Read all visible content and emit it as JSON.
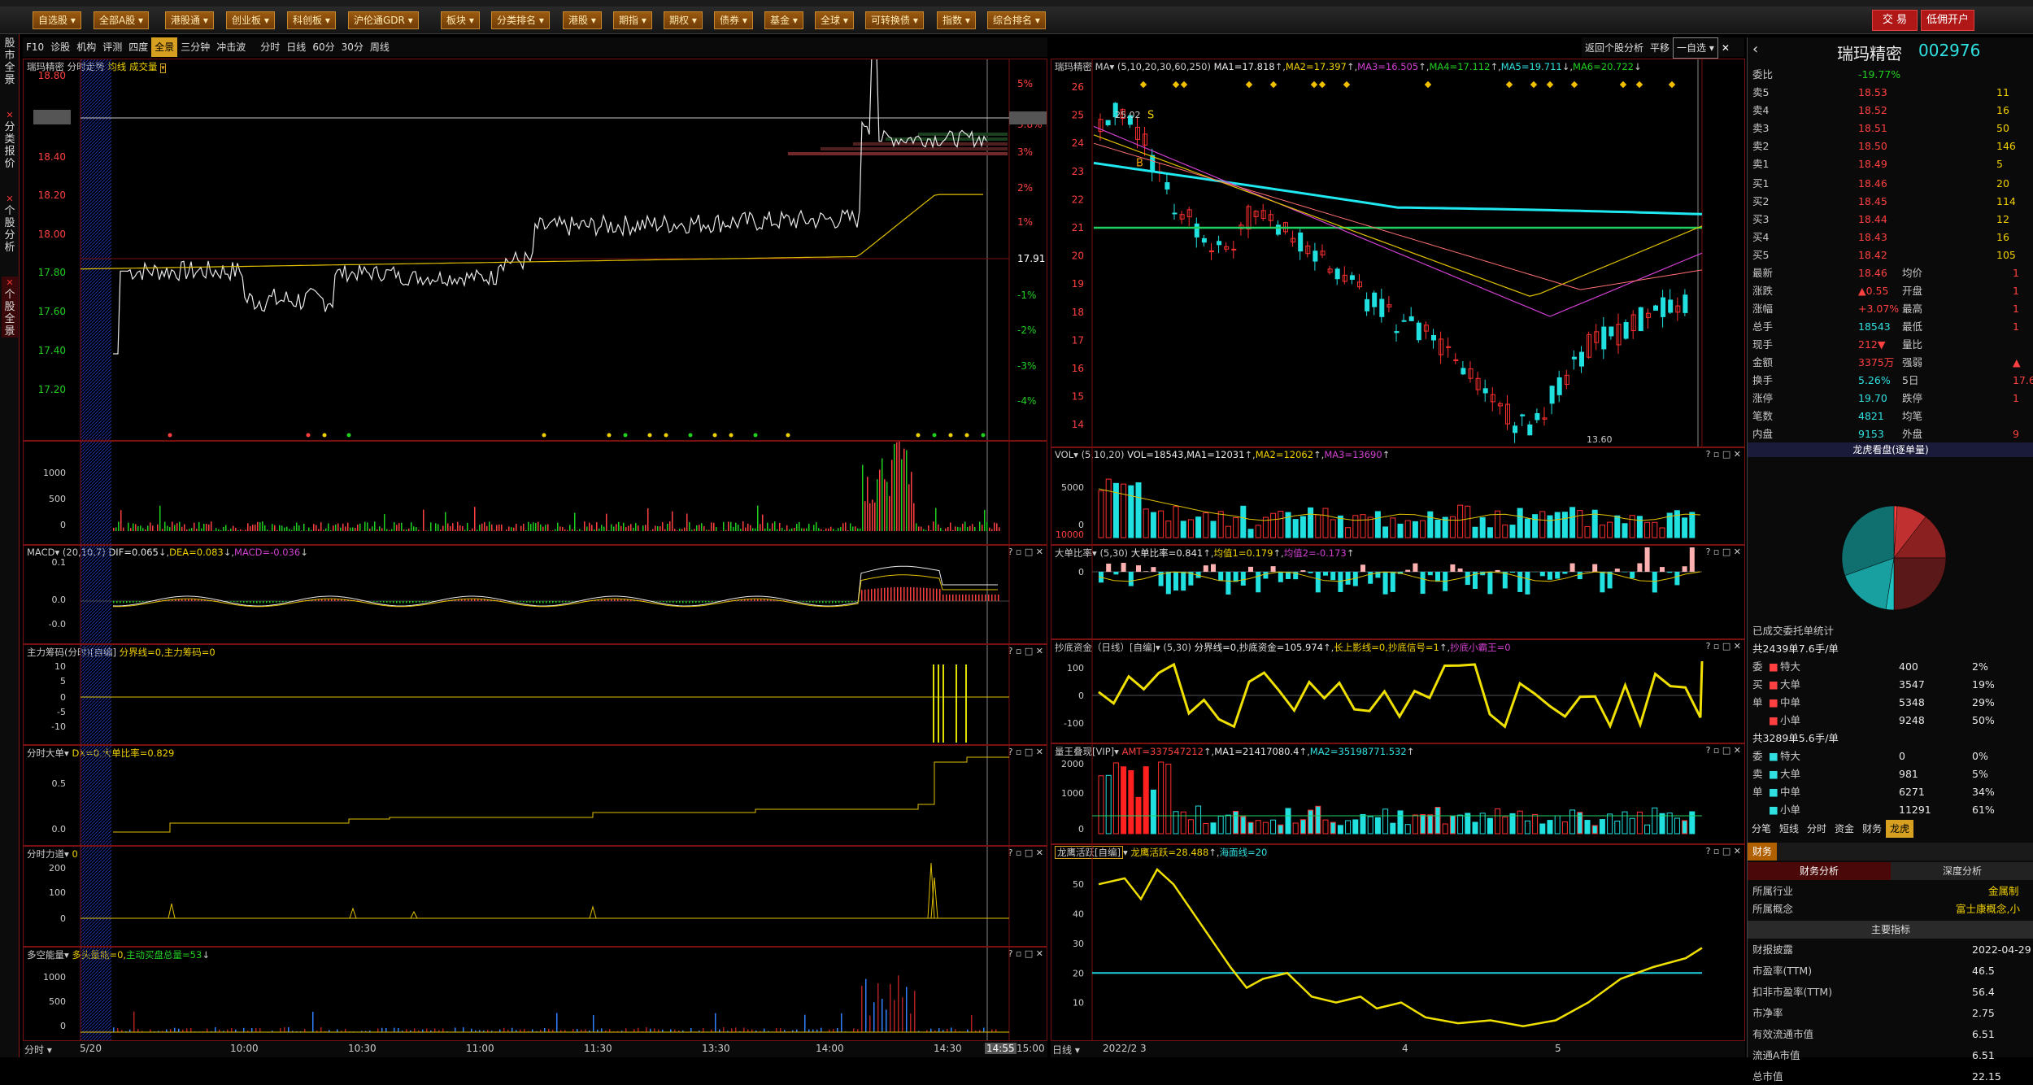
{
  "menu": {
    "items": [
      "自选股",
      "全部A股",
      "港股通",
      "创业板",
      "科创板",
      "沪伦通GDR",
      "板块",
      "分类排名",
      "港股",
      "期指",
      "期权",
      "债券",
      "基金",
      "全球",
      "可转换债",
      "指数",
      "综合排名"
    ],
    "trade": "交 易",
    "open_account": "低佣开户"
  },
  "side_tabs": [
    "股市全景",
    "分类报价",
    "个股分析",
    "个股全景"
  ],
  "toolbar_left": [
    "F10",
    "诊股",
    "机构",
    "评测",
    "四度",
    "全景",
    "三分钟",
    "冲击波",
    "分时",
    "日线",
    "60分",
    "30分",
    "周线"
  ],
  "toolbar_right": [
    "返回个股分析",
    "平移",
    "一自选"
  ],
  "intraday": {
    "title": "瑞玛精密",
    "sub": "分时走势",
    "line_avg": "均线",
    "vol": "成交量",
    "price_ticks": [
      "18.80",
      "18.59",
      "18.40",
      "18.20",
      "18.00",
      "17.80",
      "17.60",
      "17.40",
      "17.20"
    ],
    "pct_ticks": [
      "5%",
      "3.8%",
      "3%",
      "2%",
      "1%",
      "17.91",
      "-1%",
      "-2%",
      "-3%",
      "-4%"
    ],
    "vol_ticks": [
      "1000",
      "500",
      "0"
    ]
  },
  "macd": {
    "label": "MACD",
    "params": "(20,10,7)",
    "dif": "DIF=0.065",
    "dea": "DEA=0.083",
    "macd": "MACD=-0.036",
    "ticks": [
      "0.1",
      "0.0",
      "-0.0"
    ]
  },
  "zl": {
    "label": "主力筹码(分时)[自编]",
    "desc": "分界线=0,主力筹码=0",
    "ticks": [
      "10",
      "5",
      "0",
      "-5",
      "-10"
    ]
  },
  "fsdd": {
    "label": "分时大单",
    "desc": "DX=0,大单比率=0.829",
    "ticks": [
      "0.5",
      "0.0"
    ]
  },
  "fsld": {
    "label": "分时力道",
    "desc": "0",
    "ticks": [
      "200",
      "100",
      "0"
    ]
  },
  "dkn": {
    "label": "多空能量",
    "desc": "多头量能=0,",
    "desc2": "主动买盘总量=53",
    "ticks": [
      "1000",
      "500",
      "0"
    ]
  },
  "time_axis": [
    "分时",
    "5/20",
    "10:00",
    "10:30",
    "11:00",
    "11:30",
    "13:30",
    "14:00",
    "14:30",
    "14:55",
    "15:00"
  ],
  "kline": {
    "title": "瑞玛精密",
    "ma": "MA",
    "params": "(5,10,20,30,60,250)",
    "ma1": "MA1=17.818",
    "ma2": "MA2=17.397",
    "ma3": "MA3=16.505",
    "ma4": "MA4=17.112",
    "ma5": "MA5=19.711",
    "ma6": "MA6=20.722",
    "ticks": [
      "26",
      "25",
      "24",
      "23",
      "22",
      "21",
      "20",
      "19",
      "18",
      "17",
      "16",
      "15",
      "14"
    ],
    "high": "25.02",
    "low": "13.60"
  },
  "vol": {
    "label": "VOL",
    "desc": "(5,10,20)",
    "v": "VOL=18543",
    "ma1": "MA1=12031",
    "ma2": "MA2=12062",
    "ma3": "MA3=13690",
    "ticks": [
      "5000",
      "0",
      "10000"
    ]
  },
  "ddbl": {
    "label": "大单比率",
    "desc": "(5,30)",
    "v": "大单比率=0.841",
    "m1": "均值1=0.179",
    "m2": "均值2=-0.173",
    "ticks": [
      "0"
    ]
  },
  "cdzj": {
    "label": "抄底资金（日线）[自编]",
    "desc": "(5,30)",
    "v": "分界线=0,抄底资金=105.974",
    "s1": "长上影线=0,抄底信号=1",
    "s2": "抄底小霸王=0",
    "ticks": [
      "100",
      "0",
      "-100"
    ]
  },
  "lwdx": {
    "label": "量王叠现[VIP]",
    "amt": "AMT=337547212",
    "m1": "MA1=21417080.4",
    "m2": "MA2=35198771.532",
    "ticks": [
      "2000",
      "1000",
      "0"
    ]
  },
  "lyhy": {
    "label": "龙鹰活跃[自编]",
    "v": "龙鹰活跃=28.488",
    "h": "海面线=20",
    "ticks": [
      "50",
      "40",
      "30",
      "20",
      "10"
    ]
  },
  "date_axis": [
    "日线",
    "2022/2",
    "3",
    "4",
    "5"
  ],
  "quote": {
    "name": "瑞玛精密",
    "code": "002976",
    "wb_label": "委比",
    "wb": "-19.77%",
    "asks": [
      [
        "卖5",
        "18.53",
        "11"
      ],
      [
        "卖4",
        "18.52",
        "16"
      ],
      [
        "卖3",
        "18.51",
        "50"
      ],
      [
        "卖2",
        "18.50",
        "146"
      ],
      [
        "卖1",
        "18.49",
        "5"
      ]
    ],
    "bids": [
      [
        "买1",
        "18.46",
        "20"
      ],
      [
        "买2",
        "18.45",
        "114"
      ],
      [
        "买3",
        "18.44",
        "12"
      ],
      [
        "买4",
        "18.43",
        "16"
      ],
      [
        "买5",
        "18.42",
        "105"
      ]
    ],
    "stats": [
      [
        "最新",
        "18.46",
        "均价",
        "1"
      ],
      [
        "涨跌",
        "▲0.55",
        "开盘",
        "1"
      ],
      [
        "涨幅",
        "+3.07%",
        "最高",
        "1"
      ],
      [
        "总手",
        "18543",
        "最低",
        "1"
      ],
      [
        "现手",
        "212▼",
        "量比",
        ""
      ],
      [
        "金额",
        "3375万",
        "强弱",
        "▲"
      ],
      [
        "换手",
        "5.26%",
        "5日",
        "17.6"
      ],
      [
        "涨停",
        "19.70",
        "跌停",
        "1"
      ],
      [
        "笔数",
        "4821",
        "均笔",
        ""
      ],
      [
        "内盘",
        "9153",
        "外盘",
        "9"
      ]
    ],
    "pie_title": "龙虎看盘(逐单量)",
    "order_stats": "已成交委托单统计",
    "buy_total": "共2439单7.6手/单",
    "buys": [
      [
        "委",
        "特大",
        "400",
        "2%"
      ],
      [
        "买",
        "大单",
        "3547",
        "19%"
      ],
      [
        "单",
        "中单",
        "5348",
        "29%"
      ],
      [
        "",
        "小单",
        "9248",
        "50%"
      ]
    ],
    "sell_total": "共3289单5.6手/单",
    "sells": [
      [
        "委",
        "特大",
        "0",
        "0%"
      ],
      [
        "卖",
        "大单",
        "981",
        "5%"
      ],
      [
        "单",
        "中单",
        "6271",
        "34%"
      ],
      [
        "",
        "小单",
        "11291",
        "61%"
      ]
    ],
    "tabs": [
      "分笔",
      "短线",
      "分时",
      "资金",
      "财务",
      "龙虎"
    ],
    "fin_tab": "财务",
    "fin_h1": "财务分析",
    "fin_h2": "深度分析",
    "industry_l": "所属行业",
    "industry": "金属制",
    "concept_l": "所属概念",
    "concept": "富士康概念,小",
    "main_ind": "主要指标",
    "fin": [
      [
        "财报披露",
        "2022-04-29"
      ],
      [
        "市盈率(TTM)",
        "46.5"
      ],
      [
        "扣非市盈率(TTM)",
        "56.4"
      ],
      [
        "市净率",
        "2.75"
      ],
      [
        "有效流通市值",
        "6.51"
      ],
      [
        "流通A市值",
        "6.51"
      ],
      [
        "总市值",
        "22.15"
      ]
    ]
  }
}
